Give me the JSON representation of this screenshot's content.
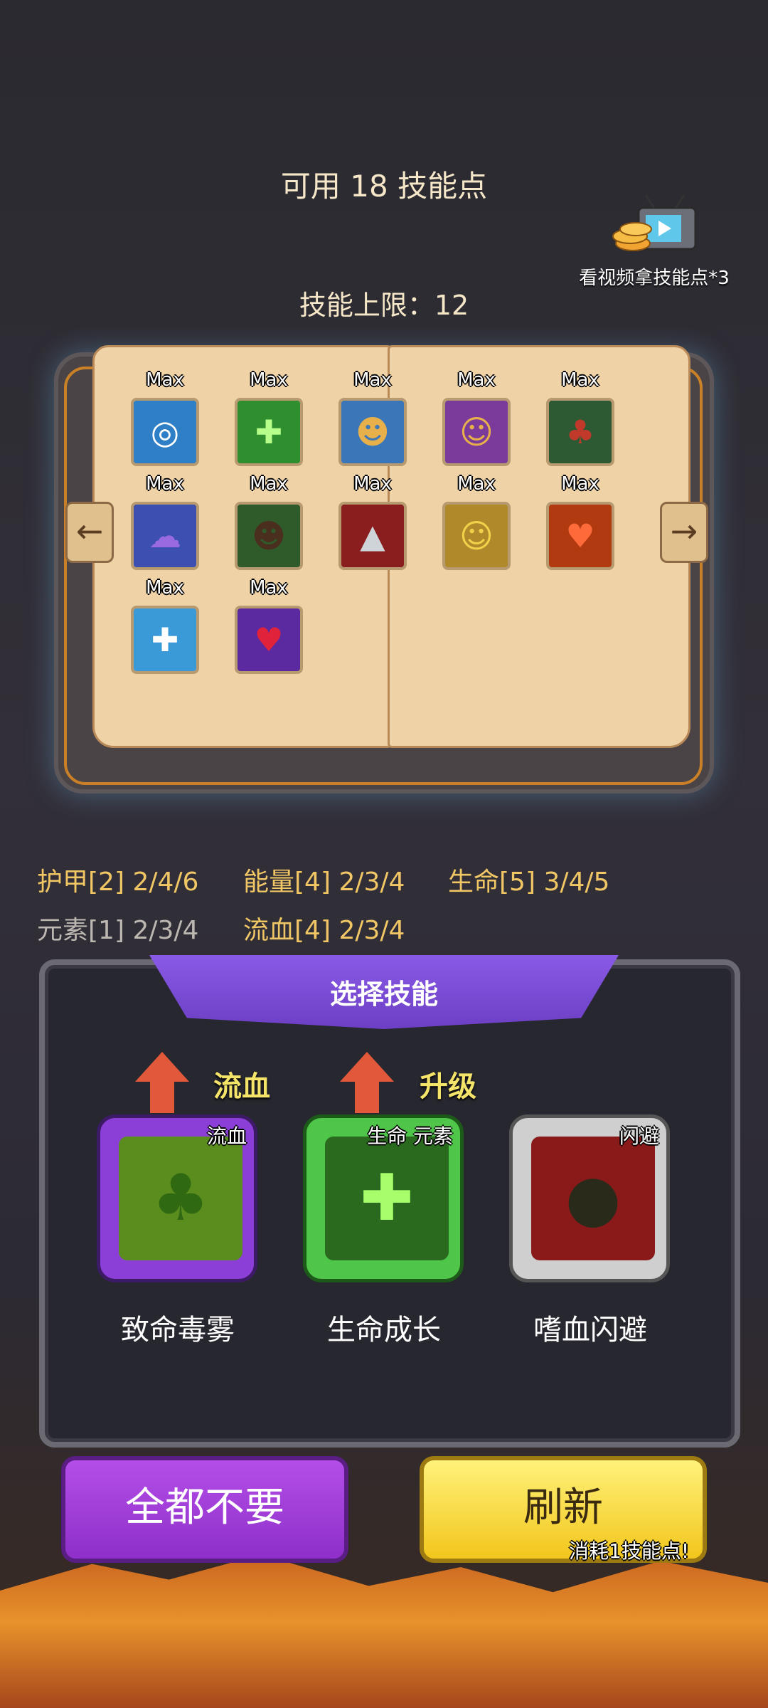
{
  "header": {
    "skill_points": "可用 18 技能点",
    "skill_limit": "技能上限：12",
    "video_reward_label": "看视频拿技能点*3"
  },
  "book": {
    "left_arrow": "←",
    "right_arrow": "→",
    "skills": [
      {
        "label": "Max",
        "icon": "water-ripple-icon",
        "color": "#2e7fc6"
      },
      {
        "label": "Max",
        "icon": "green-healing-figure-icon",
        "color": "#2f8f2e"
      },
      {
        "label": "Max",
        "icon": "duo-figures-icon",
        "color": "#3b76b8"
      },
      {
        "label": "Max",
        "icon": "spirit-attack-icon",
        "color": "#7a3b9a"
      },
      {
        "label": "Max",
        "icon": "dark-tree-icon",
        "color": "#2d5a33"
      },
      {
        "label": "Max",
        "icon": "sleeping-blob-icon",
        "color": "#3d4fb0"
      },
      {
        "label": "Max",
        "icon": "dark-figure-icon",
        "color": "#2f5a2a"
      },
      {
        "label": "Max",
        "icon": "shark-icon",
        "color": "#8a1e1e"
      },
      {
        "label": "Max",
        "icon": "yellow-figure-icon",
        "color": "#b08a2a"
      },
      {
        "label": "Max",
        "icon": "fire-heart-figure-icon",
        "color": "#b23a10"
      },
      {
        "label": "Max",
        "icon": "holy-cross-icon",
        "color": "#3a9ad8"
      },
      {
        "label": "Max",
        "icon": "heart-hand-icon",
        "color": "#5b2aa0"
      }
    ]
  },
  "stats": {
    "row1": [
      {
        "text": "护甲[2] 2/4/6",
        "color": "#f1c766"
      },
      {
        "text": "能量[4] 2/3/4",
        "color": "#f1c766"
      },
      {
        "text": "生命[5] 3/4/5",
        "color": "#f1c766"
      }
    ],
    "row2": [
      {
        "text": "元素[1] 2/3/4",
        "color": "#bdb7b2"
      },
      {
        "text": "流血[4] 2/3/4",
        "color": "#f1c766"
      }
    ]
  },
  "choose": {
    "title": "选择技能",
    "cards": [
      {
        "badge": "流血",
        "tag": "流血",
        "name": "致命毒雾",
        "icon": "poison-fog-tree-icon",
        "frame": "#8b3fd6",
        "bg": "#5a8d1e"
      },
      {
        "badge": "升级",
        "tag": "生命 元素",
        "name": "生命成长",
        "icon": "life-growth-figure-icon",
        "frame": "#4fc54a",
        "bg": "#2a6a1f"
      },
      {
        "badge": "",
        "tag": "闪避",
        "name": "嗜血闪避",
        "icon": "blood-dodge-icon",
        "frame": "#cfcfcf",
        "bg": "#8a1a1a"
      }
    ]
  },
  "buttons": {
    "skip": "全都不要",
    "refresh": "刷新",
    "refresh_cost": "消耗1技能点!"
  }
}
